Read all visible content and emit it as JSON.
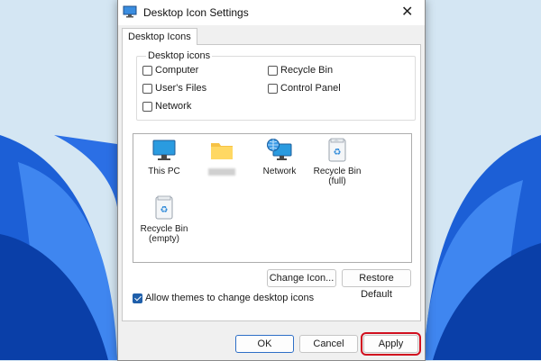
{
  "window": {
    "title": "Desktop Icon Settings",
    "close_glyph": "✕"
  },
  "tabs": [
    {
      "label": "Desktop Icons"
    }
  ],
  "desktop_icons_group": {
    "legend": "Desktop icons",
    "checkboxes": [
      {
        "label": "Computer",
        "checked": false
      },
      {
        "label": "User's Files",
        "checked": false
      },
      {
        "label": "Network",
        "checked": false
      },
      {
        "label": "Recycle Bin",
        "checked": false
      },
      {
        "label": "Control Panel",
        "checked": false
      }
    ]
  },
  "icon_list": [
    {
      "label": "This PC",
      "icon": "monitor-icon"
    },
    {
      "label": "",
      "icon": "folder-icon",
      "label_obscured": true
    },
    {
      "label": "Network",
      "icon": "network-globe-icon"
    },
    {
      "label": "Recycle Bin (full)",
      "icon": "recycle-bin-full-icon"
    },
    {
      "label": "Recycle Bin (empty)",
      "icon": "recycle-bin-empty-icon"
    }
  ],
  "buttons": {
    "change_icon": "Change Icon...",
    "restore_default": "Restore Default",
    "ok": "OK",
    "cancel": "Cancel",
    "apply": "Apply"
  },
  "allow_themes": {
    "label": "Allow themes to change desktop icons",
    "checked": true
  },
  "colors": {
    "accent": "#1f5faa",
    "highlight_box": "#d10f1f",
    "wallpaper": "#d4e6f3"
  }
}
